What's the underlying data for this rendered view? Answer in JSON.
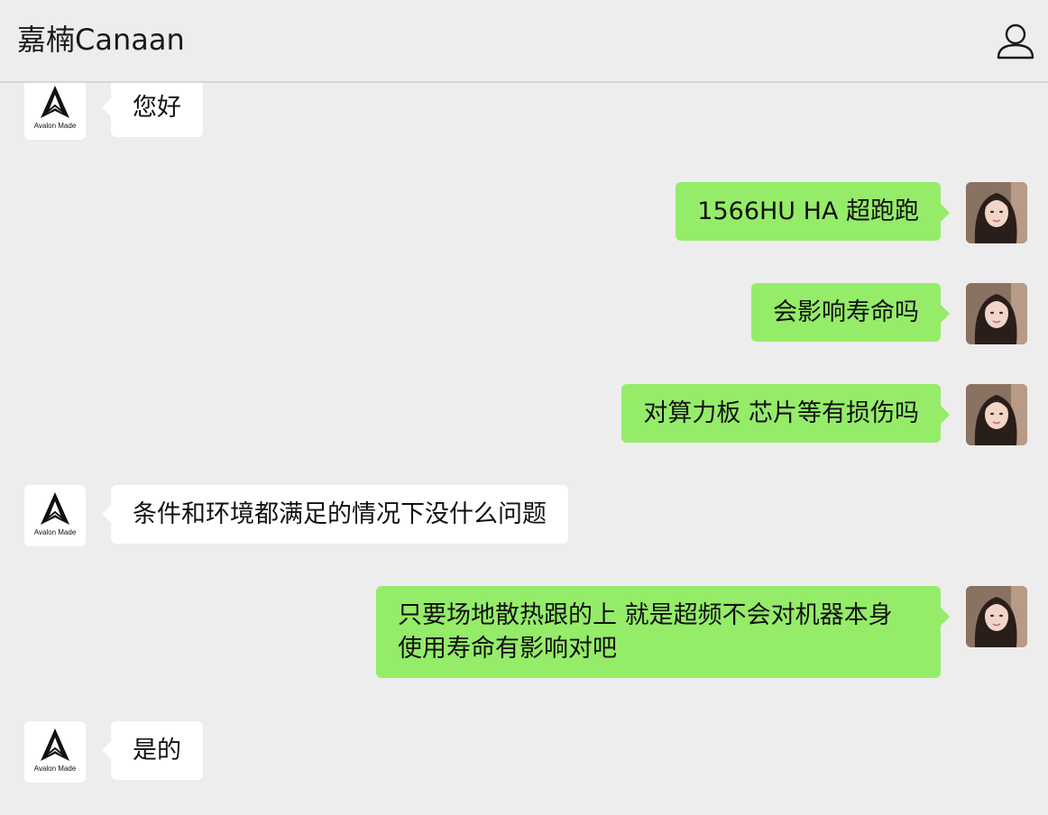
{
  "header": {
    "title": "嘉楠Canaan",
    "profile_icon": "person-outline-icon"
  },
  "contact": {
    "logo_text": "Avalon Made"
  },
  "messages": [
    {
      "side": "left",
      "text": "您好"
    },
    {
      "side": "right",
      "text": "1566HU  HA 超跑跑"
    },
    {
      "side": "right",
      "text": "会影响寿命吗"
    },
    {
      "side": "right",
      "text": "对算力板 芯片等有损伤吗"
    },
    {
      "side": "left",
      "text": "条件和环境都满足的情况下没什么问题"
    },
    {
      "side": "right",
      "lines": [
        "只要场地散热跟的上  就是超频不会对机器本身",
        "使用寿命有影响对吧"
      ]
    },
    {
      "side": "left",
      "text": "是的"
    }
  ],
  "colors": {
    "background": "#ededed",
    "sent_bubble": "#95ec69",
    "received_bubble": "#ffffff"
  }
}
